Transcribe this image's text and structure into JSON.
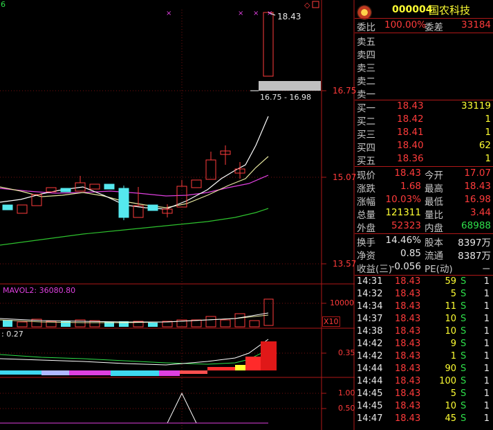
{
  "chart": {
    "corner_label": "6",
    "price_axis": [
      "16.75",
      "15.07",
      "13.57"
    ],
    "high_label": "18.43",
    "range_label": "16.75 - 16.98",
    "vol_title": "MAVOL2: 36080.80",
    "vol_axis": "10000",
    "vol_unit": "X10",
    "ind_title": ": 0.27",
    "ind_axis": "0.35",
    "ind3_axis": [
      "1.00",
      "0.50"
    ]
  },
  "quote": {
    "code": "000004",
    "name": "国农科技",
    "wb_label": "委比",
    "wb_value": "100.00%",
    "wc_label": "委差",
    "wc_value": "33184",
    "sells": [
      {
        "label": "卖五",
        "price": "",
        "vol": ""
      },
      {
        "label": "卖四",
        "price": "",
        "vol": ""
      },
      {
        "label": "卖三",
        "price": "",
        "vol": ""
      },
      {
        "label": "卖二",
        "price": "",
        "vol": ""
      },
      {
        "label": "卖一",
        "price": "",
        "vol": ""
      }
    ],
    "buys": [
      {
        "label": "买一",
        "price": "18.43",
        "vol": "33119"
      },
      {
        "label": "买二",
        "price": "18.42",
        "vol": "1"
      },
      {
        "label": "买三",
        "price": "18.41",
        "vol": "1"
      },
      {
        "label": "买四",
        "price": "18.40",
        "vol": "62"
      },
      {
        "label": "买五",
        "price": "18.36",
        "vol": "1"
      }
    ],
    "stats": [
      {
        "l1": "现价",
        "v1": "18.43",
        "l2": "今开",
        "v2": "17.07"
      },
      {
        "l1": "涨跌",
        "v1": "1.68",
        "l2": "最高",
        "v2": "18.43"
      },
      {
        "l1": "涨幅",
        "v1": "10.03%",
        "l2": "最低",
        "v2": "16.98"
      },
      {
        "l1": "总量",
        "v1": "121311",
        "l2": "量比",
        "v2": "3.44"
      },
      {
        "l1": "外盘",
        "v1": "52323",
        "l2": "内盘",
        "v2": "68988"
      }
    ],
    "fin": [
      {
        "l1": "换手",
        "v1": "14.46%",
        "l2": "股本",
        "v2": "8397万"
      },
      {
        "l1": "净资",
        "v1": "0.85",
        "l2": "流通",
        "v2": "8387万"
      },
      {
        "l1": "收益(三)",
        "v1": "-0.056",
        "l2": "PE(动)",
        "v2": "－"
      }
    ],
    "ticks": [
      {
        "time": "14:31",
        "price": "18.43",
        "vol": "59",
        "flag": "S",
        "n": "1"
      },
      {
        "time": "14:32",
        "price": "18.43",
        "vol": "5",
        "flag": "S",
        "n": "1"
      },
      {
        "time": "14:34",
        "price": "18.43",
        "vol": "11",
        "flag": "S",
        "n": "1"
      },
      {
        "time": "14:37",
        "price": "18.43",
        "vol": "10",
        "flag": "S",
        "n": "1"
      },
      {
        "time": "14:38",
        "price": "18.43",
        "vol": "10",
        "flag": "S",
        "n": "1"
      },
      {
        "time": "14:42",
        "price": "18.43",
        "vol": "9",
        "flag": "S",
        "n": "1"
      },
      {
        "time": "14:42",
        "price": "18.43",
        "vol": "1",
        "flag": "S",
        "n": "1"
      },
      {
        "time": "14:44",
        "price": "18.43",
        "vol": "90",
        "flag": "S",
        "n": "1"
      },
      {
        "time": "14:44",
        "price": "18.43",
        "vol": "100",
        "flag": "S",
        "n": "1"
      },
      {
        "time": "14:45",
        "price": "18.43",
        "vol": "5",
        "flag": "S",
        "n": "1"
      },
      {
        "time": "14:45",
        "price": "18.43",
        "vol": "10",
        "flag": "S",
        "n": "1"
      },
      {
        "time": "14:47",
        "price": "18.43",
        "vol": "45",
        "flag": "S",
        "n": "1"
      }
    ]
  }
}
